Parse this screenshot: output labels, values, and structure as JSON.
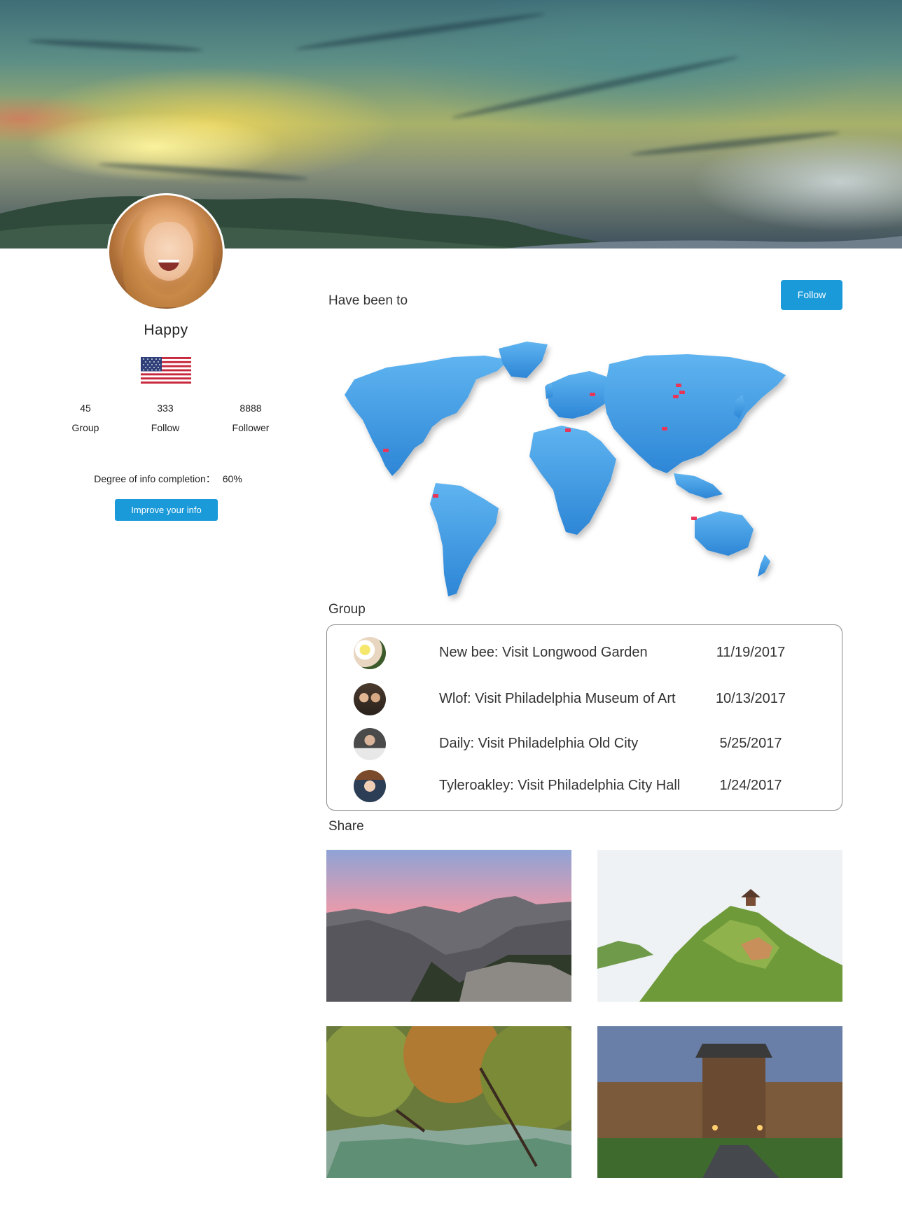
{
  "profile": {
    "name": "Happy",
    "stats": [
      {
        "value": "45",
        "label": "Group"
      },
      {
        "value": "333",
        "label": "Follow"
      },
      {
        "value": "8888",
        "label": "Follower"
      }
    ],
    "completion_label": "Degree of info completion：",
    "completion_value": "60%",
    "improve_button": "Improve your info"
  },
  "follow_button": "Follow",
  "sections": {
    "visited": "Have been to",
    "group": "Group",
    "share": "Share"
  },
  "groups": [
    {
      "title": "New bee: Visit Longwood Garden",
      "date": "11/19/2017"
    },
    {
      "title": "Wlof: Visit Philadelphia Museum of Art",
      "date": "10/13/2017"
    },
    {
      "title": "Daily: Visit Philadelphia Old City",
      "date": "5/25/2017"
    },
    {
      "title": "Tyleroakley: Visit Philadelphia City Hall",
      "date": "1/24/2017"
    }
  ],
  "colors": {
    "accent": "#1a9ad9",
    "map_land": "#3a9be6",
    "map_pin": "#e8365a"
  }
}
